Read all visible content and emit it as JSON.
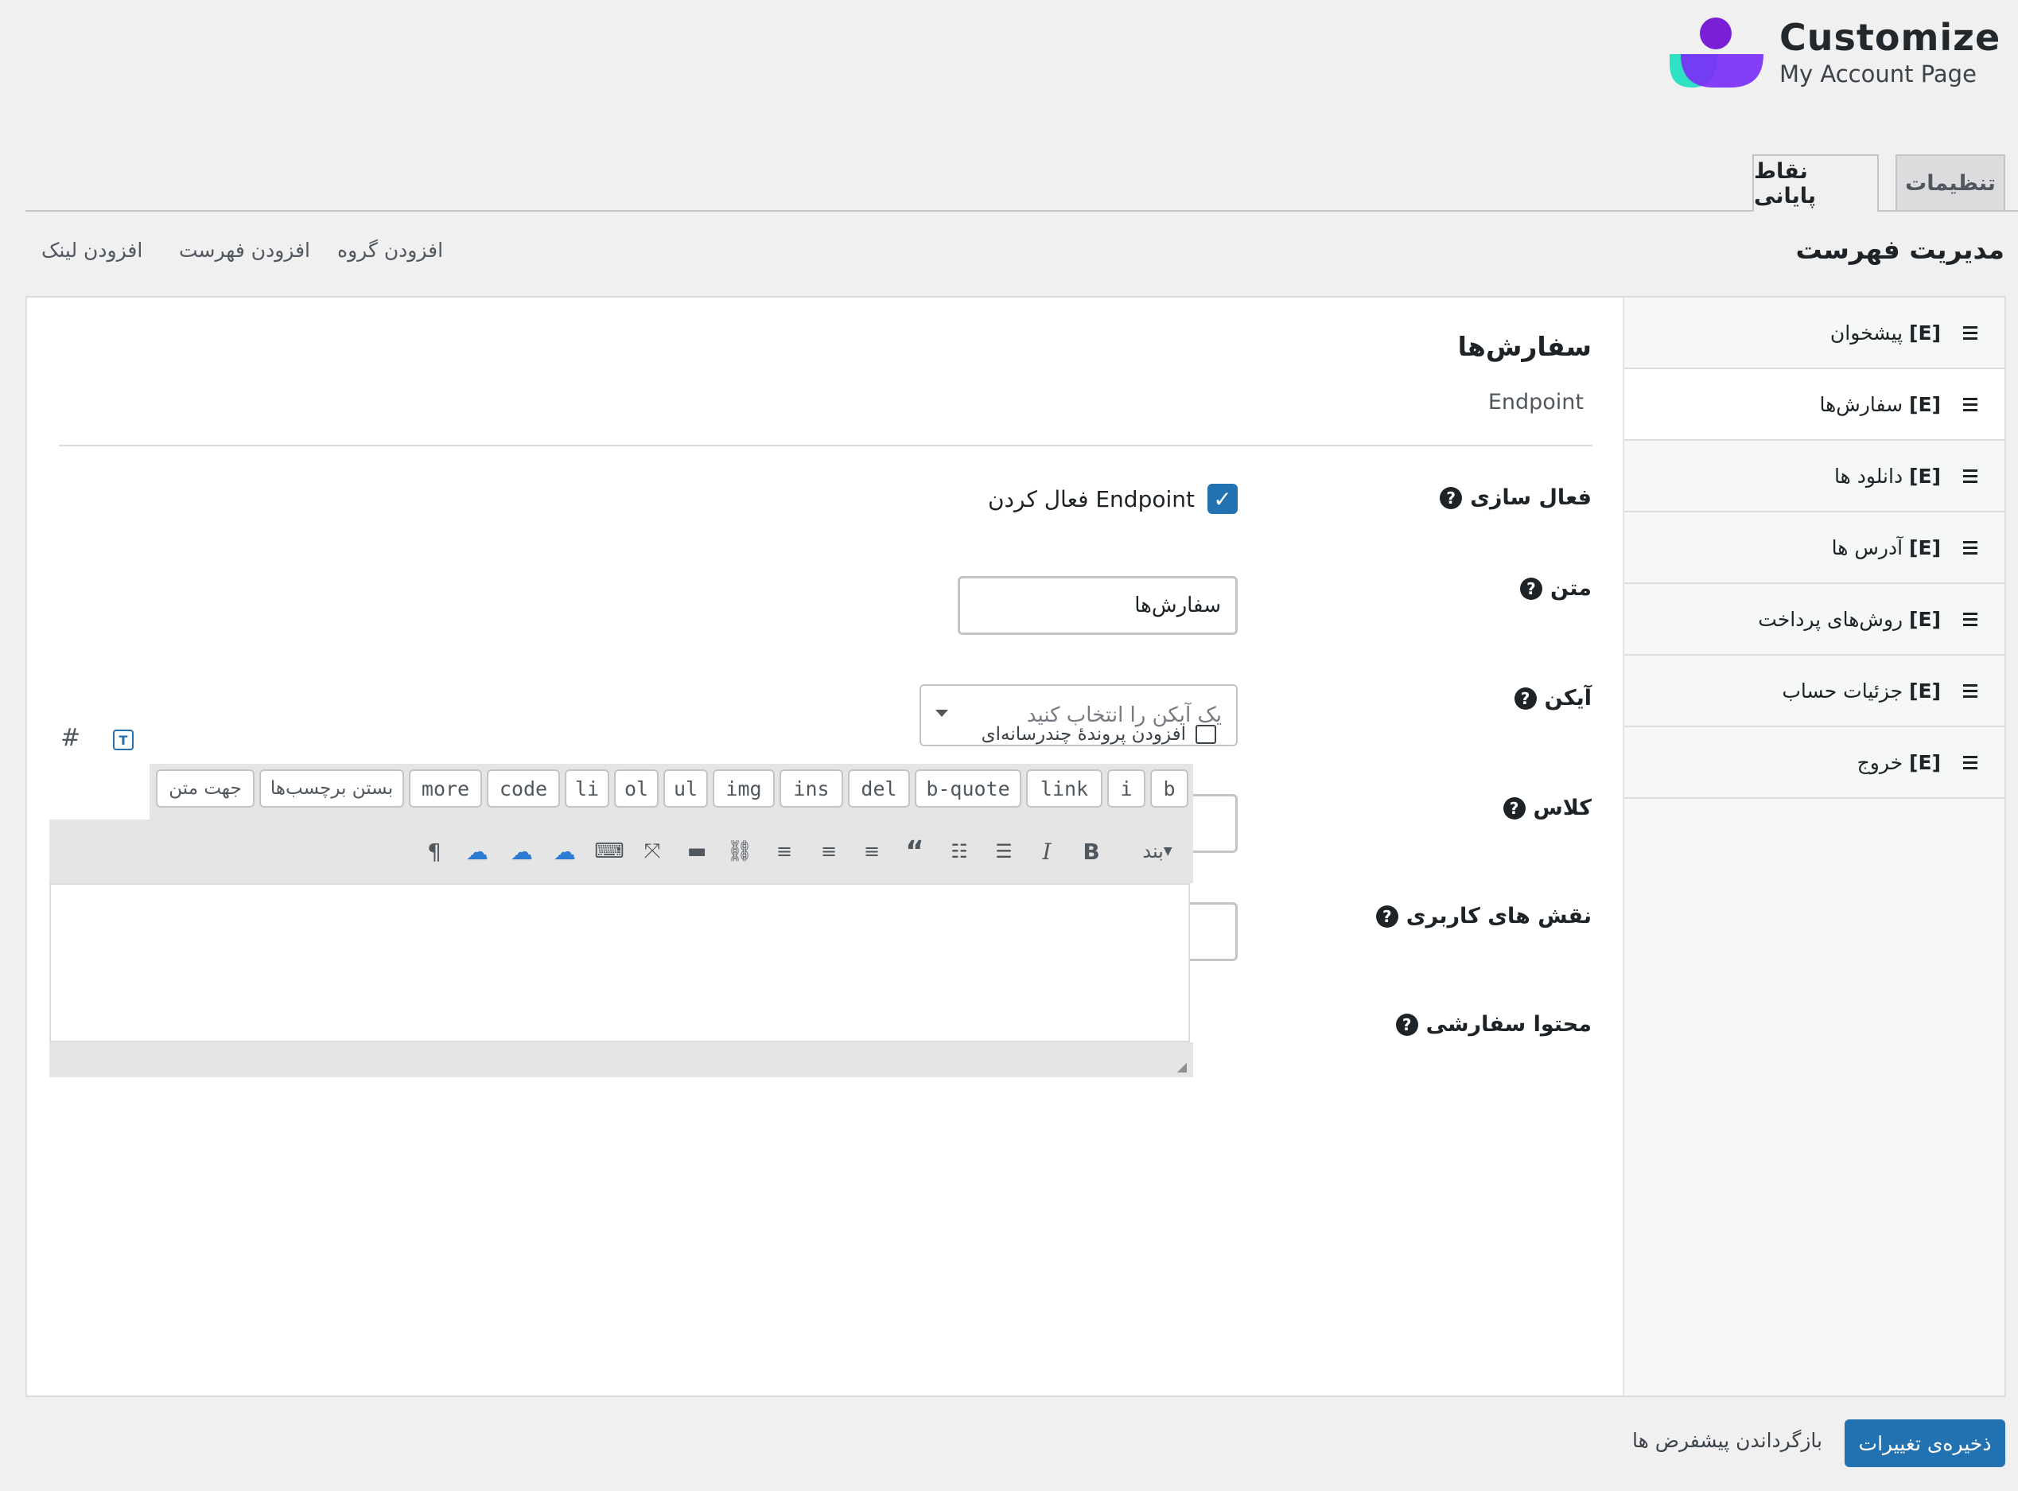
{
  "logo": {
    "title": "Customize",
    "subtitle": "My Account Page"
  },
  "tabs": [
    {
      "label": "تنظیمات"
    },
    {
      "label": "نقاط پایانی"
    }
  ],
  "header": {
    "title": "مدیریت فهرست",
    "links": {
      "add_group": "افزودن گروه",
      "add_menu": "افزودن فهرست",
      "add_link": "افزودن لینک"
    }
  },
  "sidebar": {
    "items": [
      {
        "tag": "[E]",
        "label": "پیشخوان"
      },
      {
        "tag": "[E]",
        "label": "سفارش‌ها"
      },
      {
        "tag": "[E]",
        "label": "دانلود ها"
      },
      {
        "tag": "[E]",
        "label": "آدرس ها"
      },
      {
        "tag": "[E]",
        "label": "روش‌های پرداخت"
      },
      {
        "tag": "[E]",
        "label": "جزئیات حساب"
      },
      {
        "tag": "[E]",
        "label": "خروج"
      }
    ]
  },
  "detail": {
    "title": "سفارش‌ها",
    "subtitle": "Endpoint",
    "fields": {
      "enable": {
        "label": "فعال سازی",
        "checkbox_label": "فعال کردن Endpoint",
        "checked": true
      },
      "text": {
        "label": "متن",
        "value": "سفارش‌ها"
      },
      "icon": {
        "label": "آیکن",
        "placeholder": "یک آیکن را انتخاب کنید"
      },
      "class": {
        "label": "کلاس",
        "value": ""
      },
      "roles": {
        "label": "نقش های کاربری",
        "value": ""
      },
      "content": {
        "label": "محتوا سفارشی"
      }
    }
  },
  "editor": {
    "add_media": "افزودن پروندهٔ چندرسانه‌ای",
    "quicktags": [
      "b",
      "i",
      "link",
      "b-quote",
      "del",
      "ins",
      "img",
      "ul",
      "ol",
      "li",
      "code",
      "more",
      "بستن برچسب‌ها",
      "جهت متن"
    ],
    "format_select": "بند"
  },
  "footer": {
    "save": "ذخیره‌ی تغییرات",
    "reset": "بازگرداندن پیشفرض ها"
  },
  "colors": {
    "primary": "#2271b1",
    "logo_purple": "#8a2be2",
    "logo_teal": "#2de1c2"
  }
}
